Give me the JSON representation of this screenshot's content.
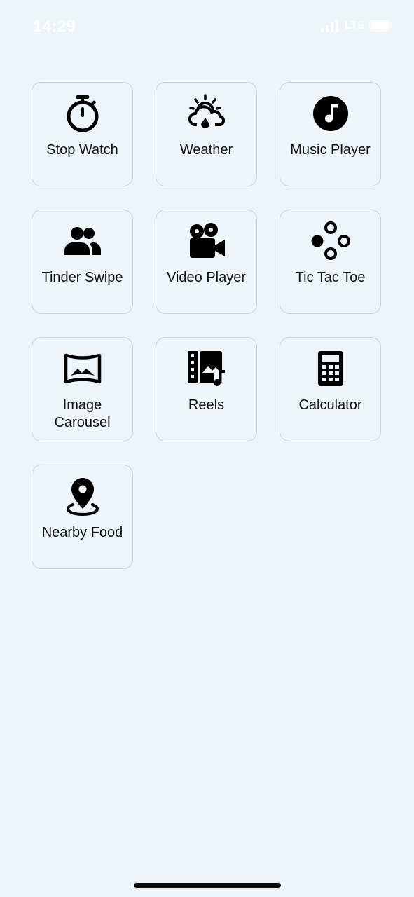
{
  "status_bar": {
    "time": "14:29",
    "network": "LTE"
  },
  "apps": [
    {
      "label": "Stop Watch",
      "icon": "stopwatch-icon"
    },
    {
      "label": "Weather",
      "icon": "weather-icon"
    },
    {
      "label": "Music Player",
      "icon": "music-note-icon"
    },
    {
      "label": "Tinder Swipe",
      "icon": "people-icon"
    },
    {
      "label": "Video Player",
      "icon": "video-camera-icon"
    },
    {
      "label": "Tic Tac Toe",
      "icon": "game-circles-icon"
    },
    {
      "label": "Image Carousel",
      "icon": "panorama-icon"
    },
    {
      "label": "Reels",
      "icon": "reels-icon"
    },
    {
      "label": "Calculator",
      "icon": "calculator-icon"
    },
    {
      "label": "Nearby Food",
      "icon": "location-pin-icon"
    }
  ]
}
